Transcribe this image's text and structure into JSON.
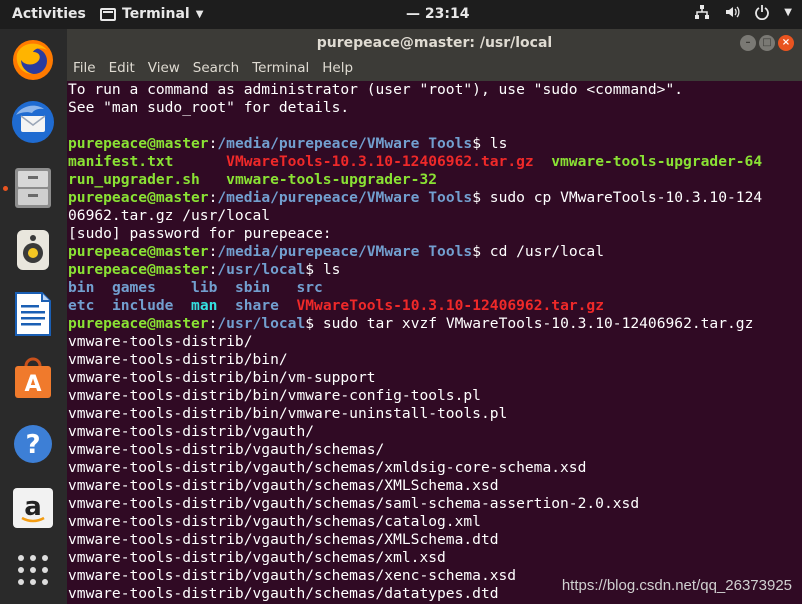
{
  "topbar": {
    "activities": "Activities",
    "app_name": "Terminal",
    "clock": "23:14"
  },
  "window": {
    "title": "purepeace@master: /usr/local",
    "menu": [
      "File",
      "Edit",
      "View",
      "Search",
      "Terminal",
      "Help"
    ]
  },
  "terminal": {
    "l01": "To run a command as administrator (user \"root\"), use \"sudo <command>\".",
    "l02": "See \"man sudo_root\" for details.",
    "prompt_user": "purepeace@master",
    "path_tools": "/media/purepeace/VMware Tools",
    "path_local": "/usr/local",
    "cmd_ls": "ls",
    "f_manifest": "manifest.txt",
    "f_tar": "VMwareTools-10.3.10-12406962.tar.gz",
    "f_upgrader64": "vmware-tools-upgrader-64",
    "f_run": "run_upgrader.sh",
    "f_upgrader32": "vmware-tools-upgrader-32",
    "cmd_cp_1": "sudo cp VMwareTools-10.3.10-124",
    "cmd_cp_2": "06962.tar.gz /usr/local",
    "sudo_prompt": "[sudo] password for purepeace:",
    "cmd_cd": "cd /usr/local",
    "d_bin": "bin",
    "d_games": "games",
    "d_lib": "lib",
    "d_sbin": "sbin",
    "d_src": "src",
    "d_etc": "etc",
    "d_include": "include",
    "d_man": "man",
    "d_share": "share",
    "cmd_tar": "sudo tar xvzf VMwareTools-10.3.10-12406962.tar.gz",
    "extract": [
      "vmware-tools-distrib/",
      "vmware-tools-distrib/bin/",
      "vmware-tools-distrib/bin/vm-support",
      "vmware-tools-distrib/bin/vmware-config-tools.pl",
      "vmware-tools-distrib/bin/vmware-uninstall-tools.pl",
      "vmware-tools-distrib/vgauth/",
      "vmware-tools-distrib/vgauth/schemas/",
      "vmware-tools-distrib/vgauth/schemas/xmldsig-core-schema.xsd",
      "vmware-tools-distrib/vgauth/schemas/XMLSchema.xsd",
      "vmware-tools-distrib/vgauth/schemas/saml-schema-assertion-2.0.xsd",
      "vmware-tools-distrib/vgauth/schemas/catalog.xml",
      "vmware-tools-distrib/vgauth/schemas/XMLSchema.dtd",
      "vmware-tools-distrib/vgauth/schemas/xml.xsd",
      "vmware-tools-distrib/vgauth/schemas/xenc-schema.xsd",
      "vmware-tools-distrib/vgauth/schemas/datatypes.dtd"
    ]
  },
  "watermark": "https://blog.csdn.net/qq_26373925",
  "colors": {
    "terminal_bg": "#300a24",
    "prompt_green": "#8ae234",
    "path_blue": "#729fcf",
    "archive_red": "#ef2929",
    "accent_orange": "#e95420"
  },
  "dock_icons": [
    "firefox-icon",
    "thunderbird-icon",
    "files-icon",
    "rhythmbox-icon",
    "writer-icon",
    "software-icon",
    "help-icon",
    "amazon-icon",
    "app-grid-icon"
  ]
}
